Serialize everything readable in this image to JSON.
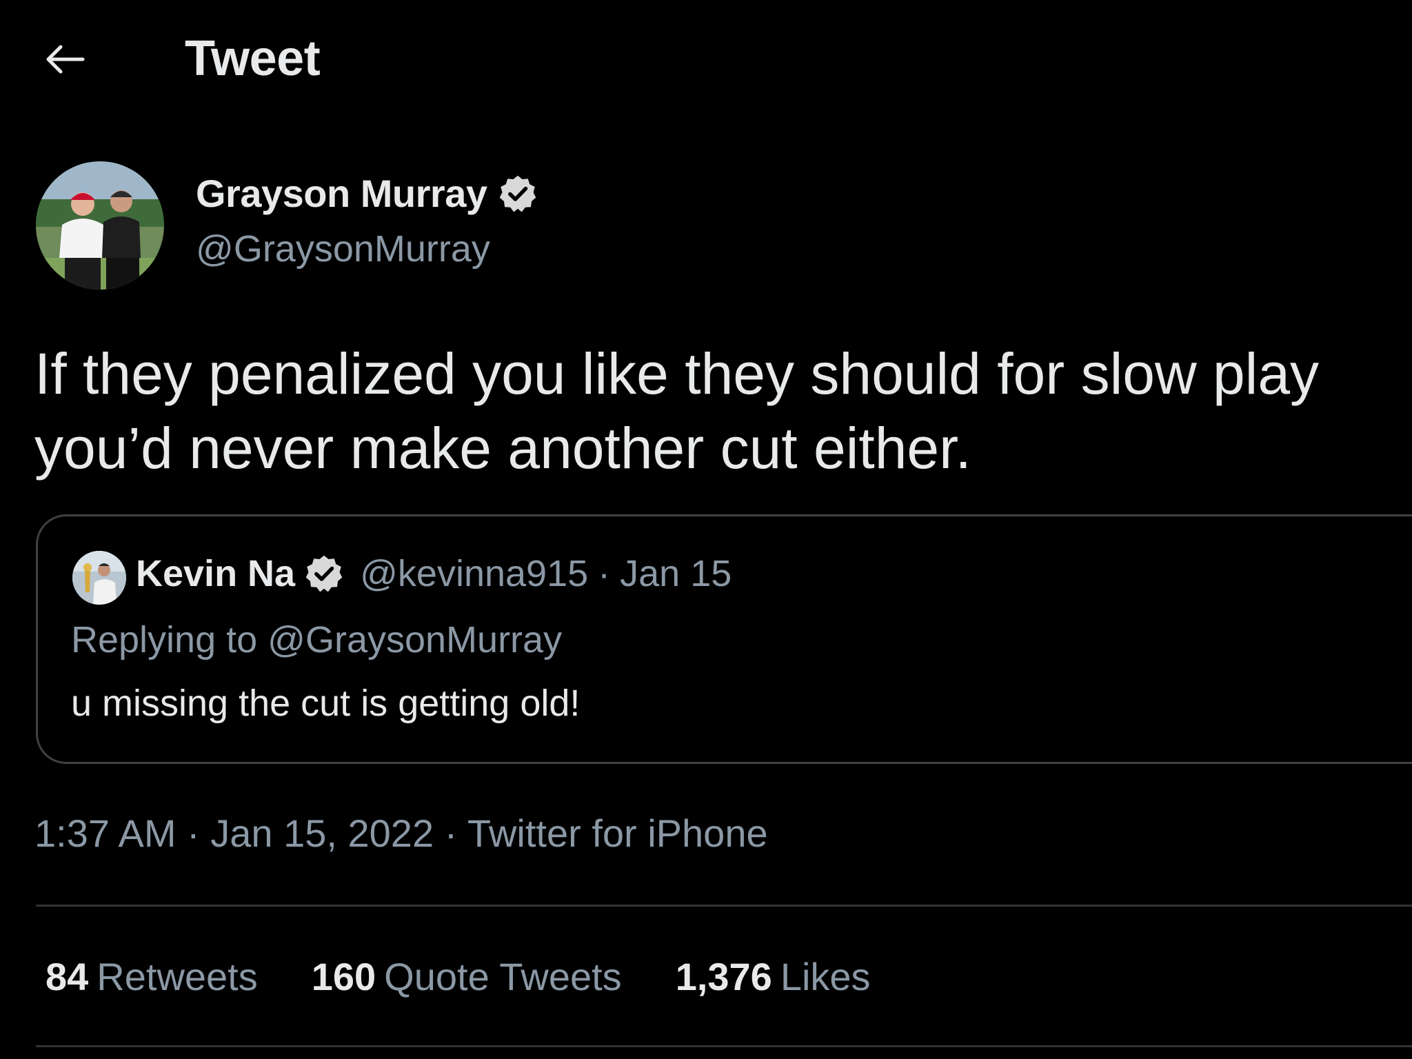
{
  "header": {
    "title": "Tweet",
    "back_icon": "arrow-left-icon"
  },
  "tweet": {
    "author": {
      "name": "Grayson Murray",
      "handle": "@GraysonMurray",
      "verified": true
    },
    "text": "If they penalized you like they should for slow play you’d never make another cut either.",
    "quoted_tweet": {
      "author_name": "Kevin Na",
      "author_handle": "@kevinna915",
      "separator": "·",
      "date": "Jan 15",
      "reply_context": "Replying to @GraysonMurray",
      "text": "u missing the cut is getting old!"
    },
    "meta": {
      "time": "1:37 AM",
      "separator": "·",
      "date": "Jan 15, 2022",
      "source": "Twitter for iPhone"
    },
    "stats": [
      {
        "count": "84",
        "label": "Retweets"
      },
      {
        "count": "160",
        "label": "Quote Tweets"
      },
      {
        "count": "1,376",
        "label": "Likes"
      }
    ]
  },
  "colors": {
    "background": "#000000",
    "primary_text": "#e7e9ea",
    "secondary_text": "#8b98a5",
    "border": "#3e4144",
    "divider": "#2f3336",
    "verified_badge": "#d9d9d9"
  }
}
